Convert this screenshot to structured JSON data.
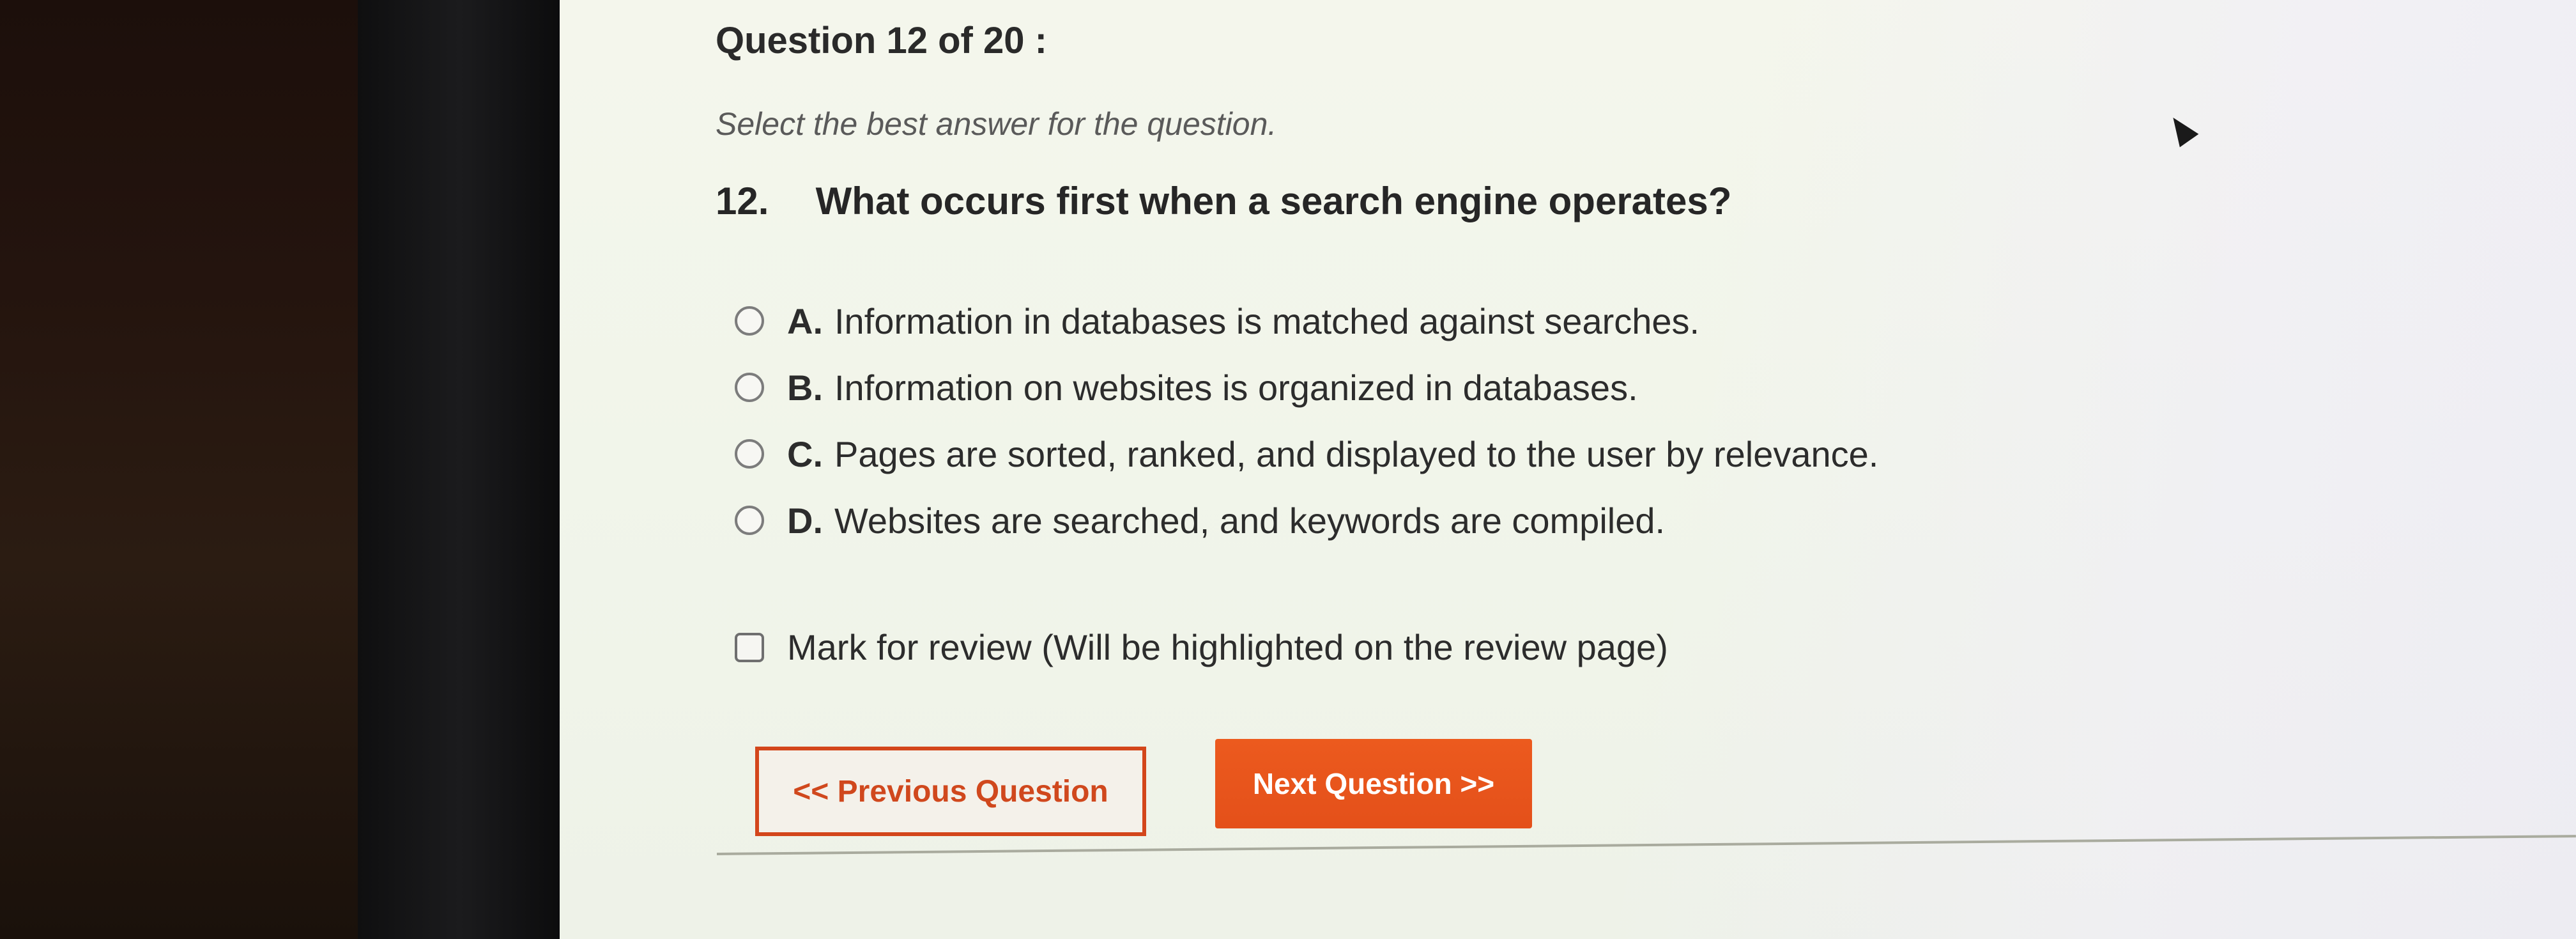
{
  "quiz": {
    "counter": "Question 12 of 20 :",
    "instructions": "Select the best answer for the question.",
    "question_number": "12.",
    "question_text": "What occurs first when a search engine operates?",
    "options": [
      {
        "letter": "A.",
        "text": "Information in databases is matched against searches."
      },
      {
        "letter": "B.",
        "text": "Information on websites is organized in databases."
      },
      {
        "letter": "C.",
        "text": "Pages are sorted, ranked, and displayed to the user by relevance."
      },
      {
        "letter": "D.",
        "text": "Websites are searched, and keywords are compiled."
      }
    ],
    "review_label": "Mark for review (Will be highlighted on the review page)",
    "prev_label": "<< Previous Question",
    "next_label": "Next Question >>"
  },
  "colors": {
    "accent": "#e4501a",
    "page_background": "#f1f5ea"
  },
  "icons": {
    "pointer": "mouse-pointer-icon",
    "option_control": "radio-circle",
    "review_control": "checkbox-square"
  }
}
